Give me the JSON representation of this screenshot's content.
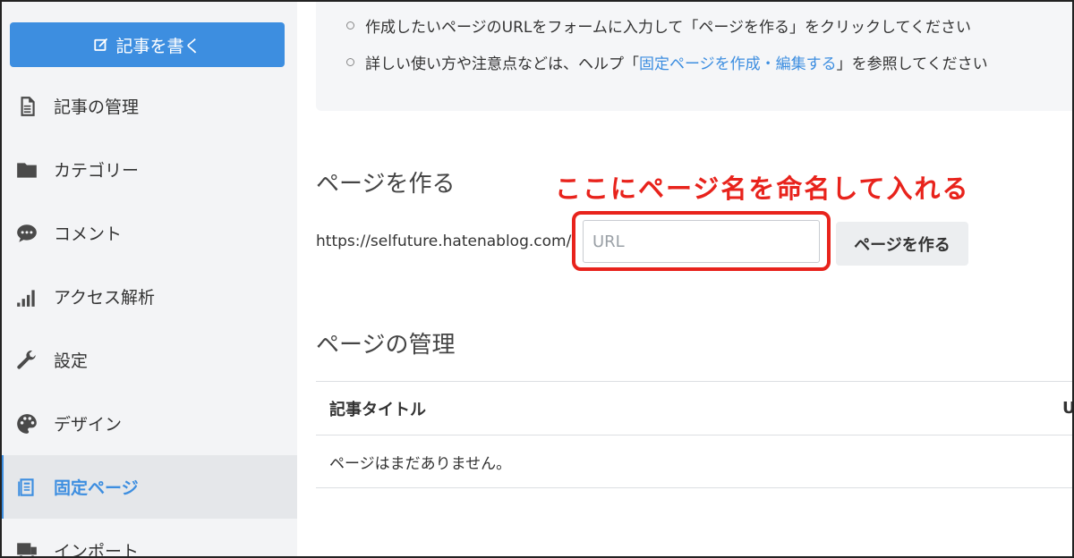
{
  "sidebar": {
    "write_label": "記事を書く",
    "items": [
      {
        "label": "記事の管理",
        "icon": "document-icon"
      },
      {
        "label": "カテゴリー",
        "icon": "folder-icon"
      },
      {
        "label": "コメント",
        "icon": "comment-icon"
      },
      {
        "label": "アクセス解析",
        "icon": "signal-bars-icon"
      },
      {
        "label": "設定",
        "icon": "wrench-icon"
      },
      {
        "label": "デザイン",
        "icon": "palette-icon"
      },
      {
        "label": "固定ページ",
        "icon": "pages-icon",
        "active": true
      },
      {
        "label": "インポート",
        "icon": "import-icon"
      }
    ]
  },
  "info": {
    "line1": "作成したいページのURLをフォームに入力して「ページを作る」をクリックしてください",
    "line2_prefix": "詳しい使い方や注意点などは、ヘルプ「",
    "line2_link": "固定ページを作成・編集する",
    "line2_suffix": "」を参照してください"
  },
  "create": {
    "title": "ページを作る",
    "annotation": "ここにページ名を命名して入れる",
    "url_prefix": "https://selfuture.hatenablog.com/",
    "url_placeholder": "URL",
    "button_label": "ページを作る"
  },
  "manage": {
    "title": "ページの管理",
    "columns": [
      "記事タイトル",
      "U"
    ],
    "empty_text": "ページはまだありません。"
  },
  "colors": {
    "accent": "#3d8ee0",
    "annotation": "#e8231c",
    "sidebar_bg": "#f3f4f6"
  }
}
